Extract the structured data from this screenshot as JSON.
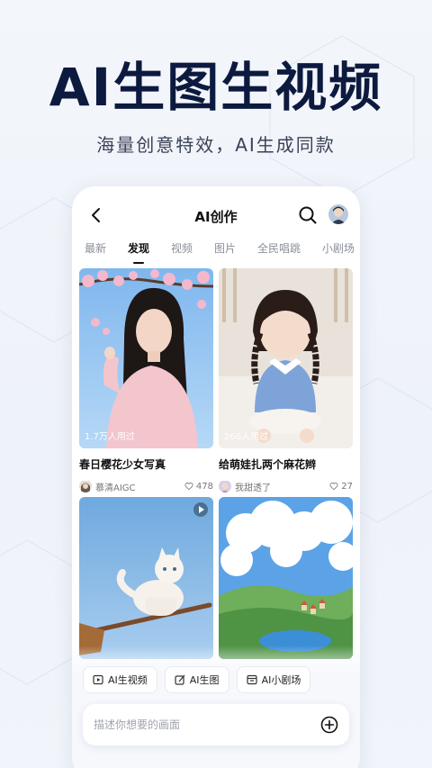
{
  "hero": {
    "headline": "AI生图生视频",
    "subline": "海量创意特效，AI生成同款"
  },
  "header": {
    "title": "AI创作",
    "back_icon": "chevron-left-icon",
    "search_icon": "search-icon",
    "avatar_icon": "user-avatar"
  },
  "tabs": [
    {
      "label": "最新",
      "active": false
    },
    {
      "label": "发现",
      "active": true
    },
    {
      "label": "视频",
      "active": false
    },
    {
      "label": "图片",
      "active": false
    },
    {
      "label": "全民唱跳",
      "active": false
    },
    {
      "label": "小剧场",
      "active": false
    }
  ],
  "cards": [
    {
      "title": "春日樱花少女写真",
      "used": "1.7万人用过",
      "author": "慕清AIGC",
      "likes": "478"
    },
    {
      "title": "给萌娃扎两个麻花辫",
      "used": "266人用过",
      "author": "我甜透了",
      "likes": "27"
    },
    {
      "title": "",
      "used": "",
      "author": "",
      "likes": ""
    },
    {
      "title": "",
      "used": "",
      "author": "",
      "likes": ""
    }
  ],
  "quick_actions": [
    {
      "label": "AI生视频",
      "icon": "video-icon"
    },
    {
      "label": "AI生图",
      "icon": "image-edit-icon"
    },
    {
      "label": "AI小剧场",
      "icon": "theater-icon"
    }
  ],
  "prompt": {
    "placeholder": "描述你想要的画面",
    "add_icon": "plus-circle-icon"
  },
  "colors": {
    "headline": "#0d1a3f",
    "background": "#f1f4fa"
  }
}
